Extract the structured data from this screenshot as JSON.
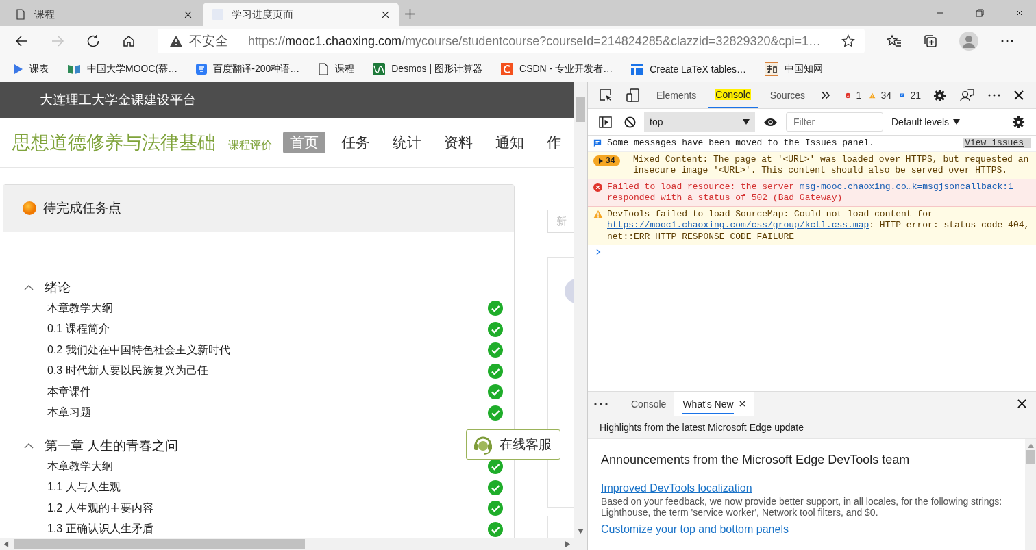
{
  "browser": {
    "tabs": [
      {
        "title": "课程",
        "kind": "document",
        "selected": false
      },
      {
        "title": "学习进度页面",
        "kind": "blank",
        "selected": true
      }
    ],
    "forward_enabled": false,
    "address": {
      "security": "不安全",
      "scheme": "https://",
      "host": "mooc1.chaoxing.com",
      "path": "/mycourse/studentcourse?courseId=214824285&clazzid=32829320&cpi=1…"
    },
    "bookmarks": [
      {
        "kind": "play",
        "label": "课表"
      },
      {
        "kind": "book",
        "label": "中国大学MOOC(慕…"
      },
      {
        "kind": "translate",
        "label": "百度翻译-200种语…"
      },
      {
        "kind": "document",
        "label": "课程"
      },
      {
        "kind": "graph",
        "label": "Desmos | 图形计算器"
      },
      {
        "kind": "csdn",
        "label": "CSDN - 专业开发者…"
      },
      {
        "kind": "table",
        "label": "Create LaTeX tables…"
      },
      {
        "kind": "cnki",
        "label": "中国知网"
      }
    ]
  },
  "page": {
    "site_title": "大连理工大学金课建设平台",
    "course_title": "思想道德修养与法律基础",
    "review_link": "课程评价",
    "nav": [
      {
        "label": "首页",
        "selected": true
      },
      {
        "label": "任务",
        "selected": false
      },
      {
        "label": "统计",
        "selected": false
      },
      {
        "label": "资料",
        "selected": false
      },
      {
        "label": "通知",
        "selected": false
      },
      {
        "label": "作",
        "selected": false
      }
    ],
    "panel_title": "待完成任务点",
    "chapters": [
      {
        "title": "绪论",
        "expanded": true,
        "children": [
          {
            "title": "本章教学大纲",
            "done": true
          },
          {
            "title": "0.1 课程简介",
            "done": true
          },
          {
            "title": "0.2 我们处在中国特色社会主义新时代",
            "done": true
          },
          {
            "title": "0.3 时代新人要以民族复兴为己任",
            "done": true
          },
          {
            "title": "本章课件",
            "done": true
          },
          {
            "title": "本章习题",
            "done": true
          }
        ]
      },
      {
        "title": "第一章 人生的青春之问",
        "expanded": true,
        "children": [
          {
            "title": "本章教学大纲",
            "done": true
          },
          {
            "title": "1.1 人与人生观",
            "done": true
          },
          {
            "title": "1.2 人生观的主要内容",
            "done": true
          },
          {
            "title": "1.3 正确认识人生矛盾",
            "done": true
          }
        ]
      }
    ],
    "search_placeholder": "新",
    "service_button": "在线客服"
  },
  "devtools": {
    "tabs": [
      {
        "label": "Elements",
        "selected": false
      },
      {
        "label": "Console",
        "selected": true
      },
      {
        "label": "Sources",
        "selected": false
      }
    ],
    "counts": {
      "errors": "1",
      "warnings": "34",
      "issues": "21"
    },
    "context": "top",
    "filter_placeholder": "Filter",
    "levels": "Default levels",
    "messages": [
      {
        "kind": "info",
        "parts": [
          {
            "text": "Some messages have been moved to the Issues panel."
          }
        ],
        "action": "View issues"
      },
      {
        "kind": "warning",
        "count": "34",
        "parts": [
          {
            "text": "Mixed Content: The page at '<URL>' was loaded over HTTPS, but requested an insecure image '<URL>'. This content should also be served over HTTPS."
          }
        ]
      },
      {
        "kind": "error",
        "parts": [
          {
            "text": "Failed to load resource: the server "
          },
          {
            "text": "msg-mooc.chaoxing.co…k=msgjsoncallback:1",
            "link": true
          },
          {
            "text": " responded with a status of 502 (Bad Gateway)"
          }
        ]
      },
      {
        "kind": "warning",
        "parts": [
          {
            "text": "DevTools failed to load SourceMap: Could not load content for "
          },
          {
            "text": "https://mooc1.chaoxing.com/css/group/kctl.css.map",
            "link": true
          },
          {
            "text": ": HTTP error: status code 404, net::ERR_HTTP_RESPONSE_CODE_FAILURE"
          }
        ]
      }
    ],
    "drawer_tabs": [
      {
        "label": "Console",
        "selected": false,
        "closable": false
      },
      {
        "label": "What's New",
        "selected": true,
        "closable": true
      }
    ],
    "highlights": "Highlights from the latest Microsoft Edge update",
    "heading": "Announcements from the Microsoft Edge DevTools team",
    "articles": [
      {
        "title": "Improved DevTools localization",
        "text": "Based on your feedback, we now provide better support, in all locales, for the following strings: Lighthouse, the term 'service worker', Network tool filters, and $0."
      },
      {
        "title": "Customize your top and bottom panels"
      }
    ]
  }
}
